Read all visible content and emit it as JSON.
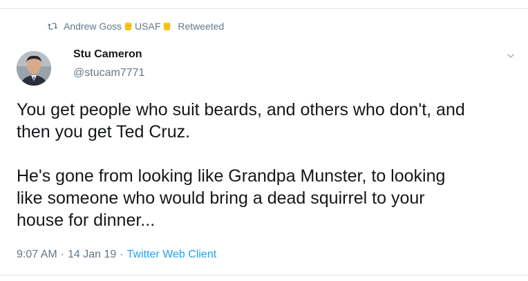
{
  "retweet": {
    "icon": "retweet-icon",
    "user_first": "Andrew Goss",
    "user_tag": "USAF",
    "emoji": "raised-fist-emoji",
    "suffix": "Retweeted"
  },
  "tweet": {
    "avatar": "avatar",
    "display_name": "Stu Cameron",
    "handle": "@stucam7771",
    "menu_icon": "chevron-down-icon",
    "paragraphs": [
      "You get people who suit beards, and others who don't, and\nthen you get Ted Cruz.",
      "He's gone from looking like Grandpa Munster, to looking\nlike someone who would bring a dead squirrel to your\nhouse for dinner..."
    ],
    "time": "9:07 AM",
    "date": "14 Jan 19",
    "separator": "·",
    "client": "Twitter Web Client"
  },
  "colors": {
    "text": "#14171a",
    "muted": "#657786",
    "link": "#1da1f2",
    "border": "#e1e8ed",
    "emoji": "#f5c518"
  }
}
